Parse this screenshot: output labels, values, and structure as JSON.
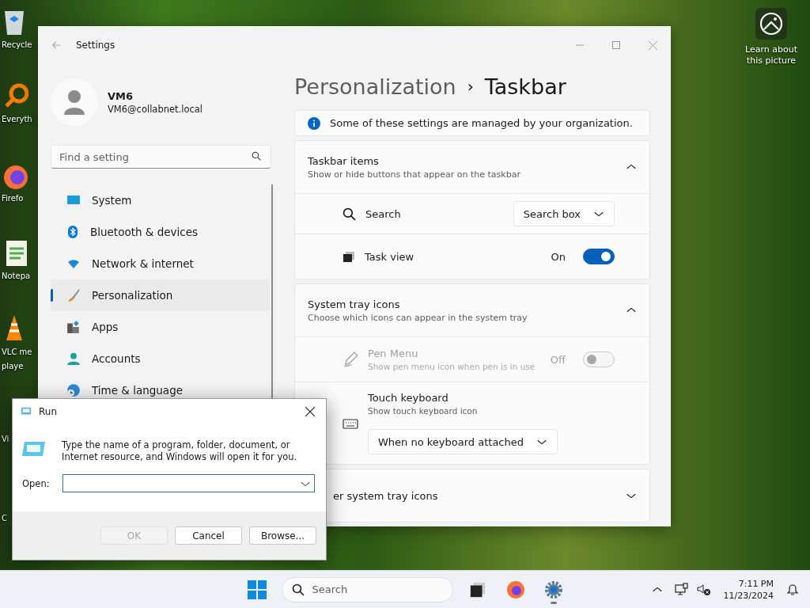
{
  "desktop": {
    "icons": [
      {
        "kind": "recycle",
        "lines": [
          "Recycle"
        ]
      },
      {
        "kind": "search",
        "lines": [
          "Everyth"
        ]
      },
      {
        "kind": "firefox",
        "lines": [
          "Firefo"
        ]
      },
      {
        "kind": "notepad",
        "lines": [
          "Notepa"
        ]
      },
      {
        "kind": "vlc",
        "lines": [
          "VLC me",
          "playe"
        ]
      },
      {
        "kind": "hidden",
        "lines": [
          "Vi"
        ]
      },
      {
        "kind": "hidden",
        "lines": [
          "C"
        ]
      }
    ],
    "spotlight": {
      "label": "Learn about this picture"
    }
  },
  "settings_window": {
    "title": "Settings",
    "user": {
      "name": "VM6",
      "email": "VM6@collabnet.local"
    },
    "search": {
      "placeholder": "Find a setting"
    },
    "nav": [
      {
        "kind": "system",
        "label": "System",
        "selected": false
      },
      {
        "kind": "bluetooth",
        "label": "Bluetooth & devices",
        "selected": false
      },
      {
        "kind": "wifi",
        "label": "Network & internet",
        "selected": false
      },
      {
        "kind": "brush",
        "label": "Personalization",
        "selected": true
      },
      {
        "kind": "apps",
        "label": "Apps",
        "selected": false
      },
      {
        "kind": "accounts",
        "label": "Accounts",
        "selected": false
      },
      {
        "kind": "time",
        "label": "Time & language",
        "selected": false
      }
    ],
    "breadcrumb": {
      "parent": "Personalization",
      "separator": "›",
      "current": "Taskbar"
    },
    "notice": "Some of these settings are managed by your organization.",
    "sections": [
      {
        "title": "Taskbar items",
        "subtitle": "Show or hide buttons that appear on the taskbar",
        "expanded": true,
        "rows": [
          {
            "kind": "dropdown",
            "label": "Search",
            "value": "Search box",
            "disabled": false
          },
          {
            "kind": "toggle",
            "label": "Task view",
            "state_label": "On",
            "on": true,
            "disabled": false
          }
        ]
      },
      {
        "title": "System tray icons",
        "subtitle": "Choose which icons can appear in the system tray",
        "expanded": true,
        "rows": [
          {
            "kind": "toggle",
            "label": "Pen Menu",
            "subtitle": "Show pen menu icon when pen is in use",
            "state_label": "Off",
            "on": false,
            "disabled": true
          },
          {
            "kind": "select_below",
            "label": "Touch keyboard",
            "subtitle": "Show touch keyboard icon",
            "value": "When no keyboard attached",
            "disabled": false
          }
        ]
      },
      {
        "title": "er system tray icons",
        "expanded": false
      }
    ]
  },
  "run_dialog": {
    "title": "Run",
    "message": "Type the name of a program, folder, document, or Internet resource, and Windows will open it for you.",
    "open_label": "Open:",
    "buttons": [
      {
        "label": "OK",
        "disabled": true
      },
      {
        "label": "Cancel",
        "disabled": false
      },
      {
        "label": "Browse...",
        "disabled": false
      }
    ]
  },
  "taskbar": {
    "search": {
      "placeholder": "Search"
    },
    "apps": [
      {
        "kind": "taskview",
        "active": false
      },
      {
        "kind": "firefox",
        "active": false
      },
      {
        "kind": "settings",
        "active": true
      }
    ],
    "time": "7:11 PM",
    "date": "11/23/2024"
  }
}
